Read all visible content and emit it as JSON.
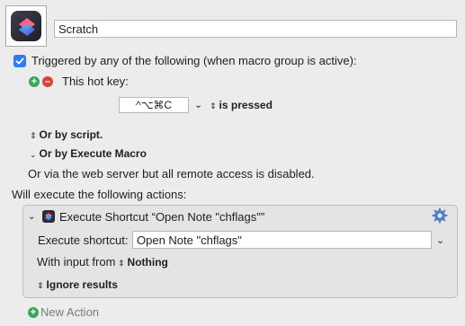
{
  "macro": {
    "name": "Scratch"
  },
  "trigger": {
    "checked": true,
    "description": "Triggered by any of the following (when macro group is active):",
    "hotkey_label": "This hot key:",
    "hotkey_value": "^⌥⌘C",
    "hotkey_condition": "is pressed",
    "or_by_script": "Or by script.",
    "or_by_execute_macro": "Or by Execute Macro",
    "web_server_note": "Or via the web server but all remote access is disabled."
  },
  "actions_heading": "Will execute the following actions:",
  "action": {
    "title": "Execute Shortcut “Open Note \"chflags\"”",
    "shortcut_label": "Execute shortcut:",
    "shortcut_value": "Open Note \"chflags\"",
    "input_label": "With input from",
    "input_value": "Nothing",
    "results_option": "Ignore results"
  },
  "new_action_label": "New Action",
  "icons": {
    "app": "shortcuts-app-icon",
    "gear": "gear-icon"
  },
  "colors": {
    "checkbox_blue": "#2f7cf6",
    "add_green": "#3aa65b",
    "remove_red": "#d9413a"
  }
}
